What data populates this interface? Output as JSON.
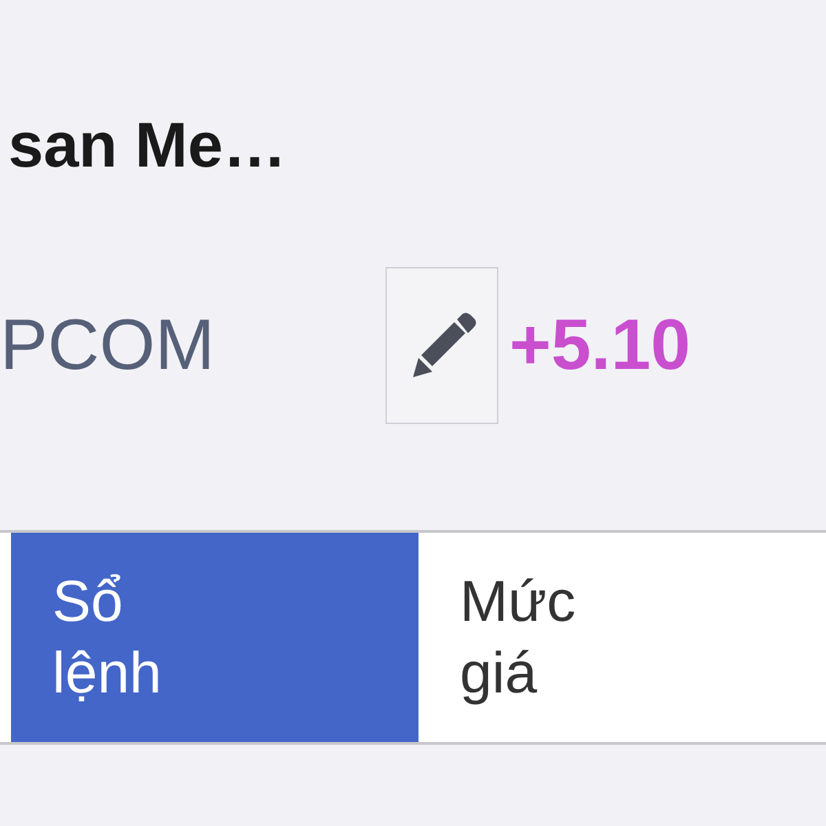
{
  "title": "san Me…",
  "exchange": "PCOM",
  "change": "+5.10",
  "tabs": [
    {
      "label": "Sổ lệnh",
      "selected": true
    },
    {
      "label": "Mức giá",
      "selected": false
    }
  ]
}
